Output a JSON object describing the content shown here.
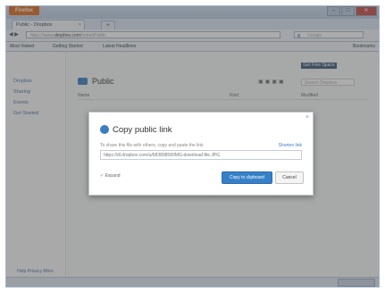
{
  "browser": {
    "app_button": "Firefox",
    "tab_title": "Public - Dropbox",
    "url_prefix": "https://www.",
    "url_domain": "dropbox.com",
    "url_path": "/home/Public",
    "search_placeholder": "Google",
    "bookmarks": [
      "Most Visited",
      "Getting Started",
      "Latest Headlines"
    ],
    "bookmarks_right": "Bookmarks"
  },
  "sidebar": {
    "items": [
      "Dropbox",
      "Sharing",
      "Events",
      "Get Started"
    ],
    "footer": "Help  Privacy  More"
  },
  "main": {
    "folder_title": "Public",
    "top_button": "Get Free Space",
    "search_placeholder": "Search Dropbox",
    "columns": [
      "Name",
      "Kind",
      "Modified"
    ]
  },
  "dialog": {
    "title": "Copy public link",
    "description": "To share this file with others, copy and paste the link",
    "disable_link": "Shorten link",
    "url": "https://dl.dropbox.com/u/68389858/IMG-download-file.JPG",
    "expand_label": "Expand",
    "primary_button": "Copy to clipboard",
    "cancel_button": "Cancel"
  },
  "colors": {
    "accent": "#3680c8",
    "firefox_orange": "#e06a1a",
    "overlay": "rgba(70,70,70,0.45)"
  }
}
